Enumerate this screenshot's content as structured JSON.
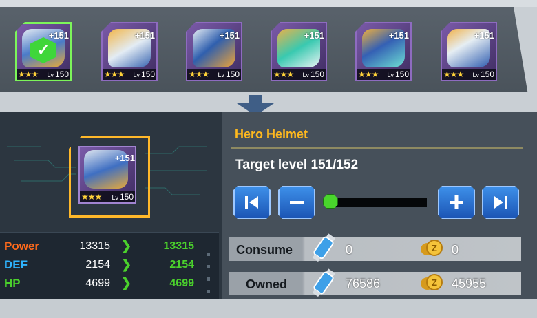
{
  "colors": {
    "accent": "#ffb91e",
    "selected": "#7df55a",
    "next_value": "#4bd12c",
    "power": "#ff6a1c",
    "def": "#2fb4ff",
    "hp": "#4bd12c",
    "button": "#2b74d4"
  },
  "slots": [
    {
      "plus": "+151",
      "stars": "★★★",
      "lv_label": "Lv",
      "level": "150",
      "icon": "helmet-icon",
      "selected": true
    },
    {
      "plus": "+151",
      "stars": "★★★",
      "lv_label": "Lv",
      "level": "150",
      "icon": "shoulder-armor-icon",
      "selected": false
    },
    {
      "plus": "+151",
      "stars": "★★★",
      "lv_label": "Lv",
      "level": "150",
      "icon": "gauntlet-icon",
      "selected": false
    },
    {
      "plus": "+151",
      "stars": "★★★",
      "lv_label": "Lv",
      "level": "150",
      "icon": "chest-armor-icon",
      "selected": false
    },
    {
      "plus": "+151",
      "stars": "★★★",
      "lv_label": "Lv",
      "level": "150",
      "icon": "leg-armor-icon",
      "selected": false
    },
    {
      "plus": "+151",
      "stars": "★★★",
      "lv_label": "Lv",
      "level": "150",
      "icon": "boot-icon",
      "selected": false
    }
  ],
  "preview": {
    "plus": "+151",
    "stars": "★★★",
    "lv_label": "Lv",
    "level": "150",
    "icon": "helmet-icon"
  },
  "stats": [
    {
      "name": "Power",
      "current": "13315",
      "next": "13315"
    },
    {
      "name": "DEF",
      "current": "2154",
      "next": "2154"
    },
    {
      "name": "HP",
      "current": "4699",
      "next": "4699"
    }
  ],
  "detail": {
    "title": "Hero Helmet",
    "target_level": "Target level 151/152",
    "progress": 0.0
  },
  "controls": {
    "first": "first-level-icon",
    "minus": "minus-icon",
    "plus": "plus-icon",
    "last": "last-level-icon"
  },
  "consume": {
    "label": "Consume",
    "potion": "0",
    "coin": "0"
  },
  "owned": {
    "label": "Owned",
    "potion": "76586",
    "coin": "45955"
  }
}
